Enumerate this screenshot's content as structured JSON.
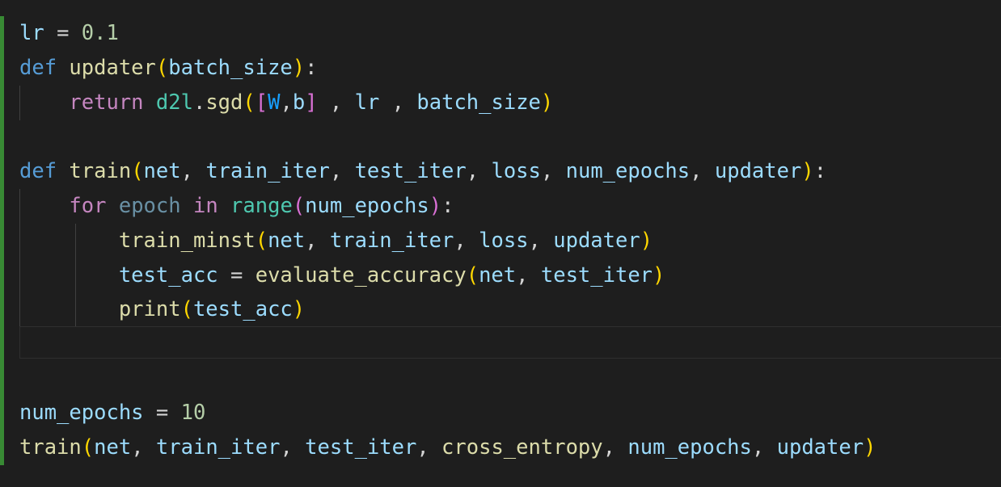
{
  "editor": {
    "colors": {
      "background": "#1e1e1e",
      "gutter_modified": "#388a34",
      "keyword": "#569cd6",
      "control": "#c586c0",
      "function": "#dcdcaa",
      "variable": "#9cdcfe",
      "number": "#b5cea8",
      "bracket_level1": "#ffd700",
      "bracket_level2": "#da70d6",
      "bracket_level3": "#179fff"
    },
    "lines": [
      {
        "tokens": [
          "lr",
          " = ",
          "0.1"
        ]
      },
      {
        "tokens": [
          "def",
          " ",
          "updater",
          "(",
          "batch_size",
          ")",
          ":"
        ]
      },
      {
        "tokens": [
          "    ",
          "return",
          " ",
          "d2l",
          ".",
          "sgd",
          "(",
          "[",
          "W",
          ",",
          "b",
          "]",
          " , ",
          "lr",
          " , ",
          "batch_size",
          ")"
        ]
      },
      {
        "tokens": []
      },
      {
        "tokens": [
          "def",
          " ",
          "train",
          "(",
          "net",
          ", ",
          "train_iter",
          ", ",
          "test_iter",
          ", ",
          "loss",
          ", ",
          "num_epochs",
          ", ",
          "updater",
          ")",
          ":"
        ]
      },
      {
        "tokens": [
          "    ",
          "for",
          " ",
          "epoch",
          " ",
          "in",
          " ",
          "range",
          "(",
          "num_epochs",
          ")",
          ":"
        ]
      },
      {
        "tokens": [
          "        ",
          "train_minst",
          "(",
          "net",
          ", ",
          "train_iter",
          ", ",
          "loss",
          ", ",
          "updater",
          ")"
        ]
      },
      {
        "tokens": [
          "        ",
          "test_acc",
          " = ",
          "evaluate_accuracy",
          "(",
          "net",
          ", ",
          "test_iter",
          ")"
        ]
      },
      {
        "tokens": [
          "        ",
          "print",
          "(",
          "test_acc",
          ")"
        ]
      },
      {
        "tokens": []
      },
      {
        "tokens": []
      },
      {
        "tokens": [
          "num_epochs",
          " = ",
          "10"
        ]
      },
      {
        "tokens": [
          "train",
          "(",
          "net",
          ", ",
          "train_iter",
          ", ",
          "test_iter",
          ", ",
          "cross_entropy",
          ", ",
          "num_epochs",
          ", ",
          "updater",
          ")"
        ]
      }
    ]
  }
}
